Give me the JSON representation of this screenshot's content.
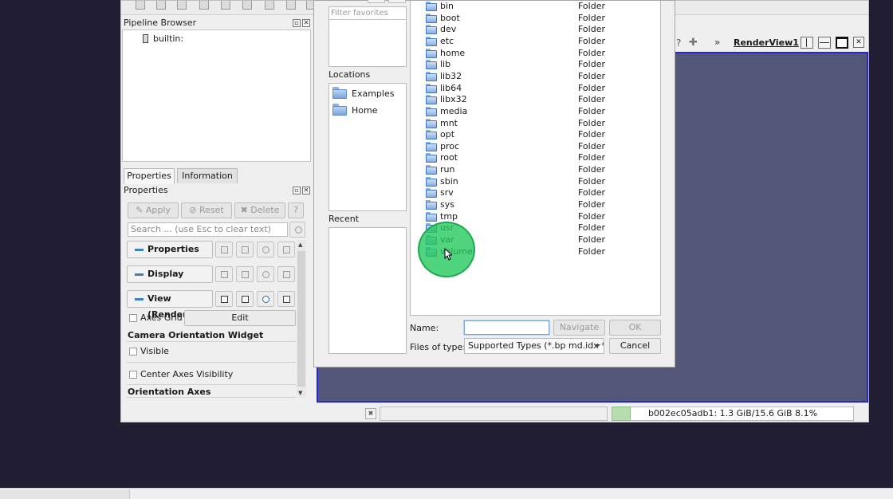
{
  "pipeline": {
    "title": "Pipeline Browser",
    "root_item": "builtin:"
  },
  "tabs": [
    "Properties",
    "Information"
  ],
  "properties": {
    "title": "Properties",
    "apply_label": "Apply",
    "reset_label": "Reset",
    "delete_label": "Delete",
    "help_label": "?",
    "search_placeholder": "Search ... (use Esc to clear text)",
    "sections": [
      "Properties",
      "Display",
      "View (Render"
    ],
    "axes_grid_label": "Axes Grid",
    "edit_label": "Edit",
    "camera_widget_label": "Camera Orientation Widget",
    "visible_label": "Visible",
    "center_axes_label": "Center Axes Visibility",
    "orientation_axes_label": "Orientation Axes"
  },
  "render_view": {
    "title": "RenderView1",
    "help_glyph": "?",
    "plus_glyph": "✚",
    "more_glyph": "»"
  },
  "status": {
    "memory": "b002ec05adb1: 1.3 GiB/15.6 GiB 8.1%",
    "memory_fraction": 0.081
  },
  "dialog": {
    "favorites_placeholder": "Filter favorites",
    "locations_label": "Locations",
    "locations": [
      "Examples",
      "Home"
    ],
    "recent_label": "Recent",
    "files": [
      {
        "name": "bin",
        "type": "Folder"
      },
      {
        "name": "boot",
        "type": "Folder"
      },
      {
        "name": "dev",
        "type": "Folder"
      },
      {
        "name": "etc",
        "type": "Folder"
      },
      {
        "name": "home",
        "type": "Folder"
      },
      {
        "name": "lib",
        "type": "Folder"
      },
      {
        "name": "lib32",
        "type": "Folder"
      },
      {
        "name": "lib64",
        "type": "Folder"
      },
      {
        "name": "libx32",
        "type": "Folder"
      },
      {
        "name": "media",
        "type": "Folder"
      },
      {
        "name": "mnt",
        "type": "Folder"
      },
      {
        "name": "opt",
        "type": "Folder"
      },
      {
        "name": "proc",
        "type": "Folder"
      },
      {
        "name": "root",
        "type": "Folder"
      },
      {
        "name": "run",
        "type": "Folder"
      },
      {
        "name": "sbin",
        "type": "Folder"
      },
      {
        "name": "srv",
        "type": "Folder"
      },
      {
        "name": "sys",
        "type": "Folder"
      },
      {
        "name": "tmp",
        "type": "Folder"
      },
      {
        "name": "usr",
        "type": "Folder"
      },
      {
        "name": "var",
        "type": "Folder"
      },
      {
        "name": "volume",
        "type": "Folder"
      }
    ],
    "name_label": "Name:",
    "name_value": "",
    "navigate_label": "Navigate",
    "ok_label": "OK",
    "filetype_label": "Files of type:",
    "filetype_value": "Supported Types (*.bp md.idx *.",
    "cancel_label": "Cancel"
  },
  "colors": {
    "render_bg": "#52577a",
    "render_border": "#2626d6",
    "click_indicator": "#20c85a",
    "desktop_bg": "#211d33"
  }
}
